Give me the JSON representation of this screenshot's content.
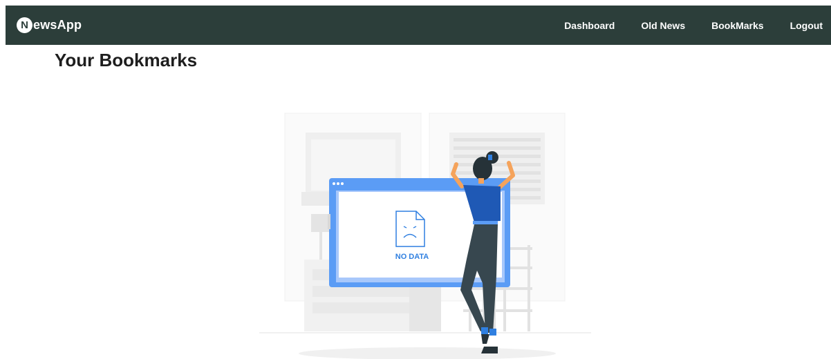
{
  "navbar": {
    "logo_letter": "N",
    "brand_text": "ewsApp",
    "links": [
      {
        "label": "Dashboard"
      },
      {
        "label": "Old News"
      },
      {
        "label": "BookMarks"
      },
      {
        "label": "Logout"
      }
    ]
  },
  "main": {
    "title": "Your Bookmarks",
    "empty_state": {
      "label": "NO DATA"
    }
  },
  "colors": {
    "navbar_bg": "#2c3e3a",
    "accent_blue": "#2f7fe0",
    "screen_frame": "#5b9cf5"
  }
}
